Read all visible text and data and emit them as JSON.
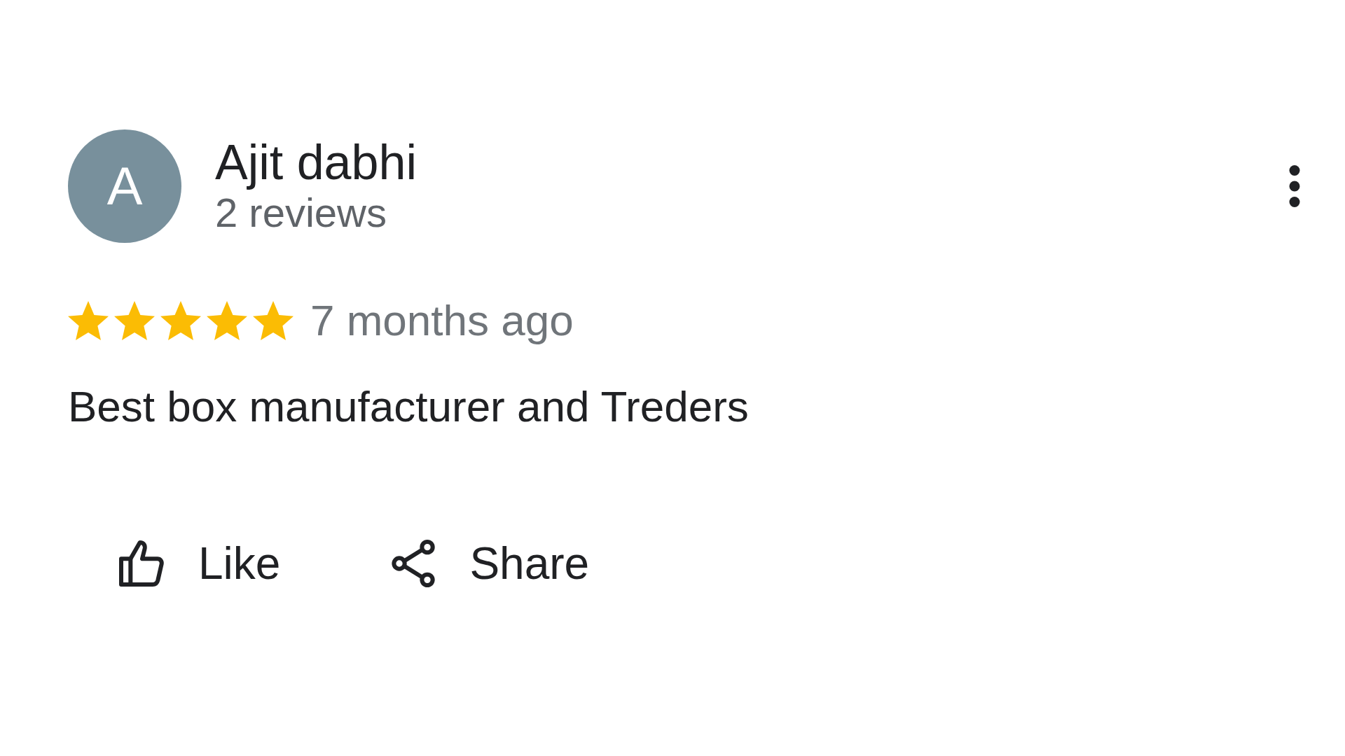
{
  "review": {
    "avatar_letter": "A",
    "author": "Ajit dabhi",
    "author_meta": "2 reviews",
    "stars": 5,
    "time": "7 months ago",
    "text": "Best box manufacturer and Treders",
    "actions": [
      {
        "kind": "like",
        "label": "Like"
      },
      {
        "kind": "share",
        "label": "Share"
      }
    ]
  }
}
